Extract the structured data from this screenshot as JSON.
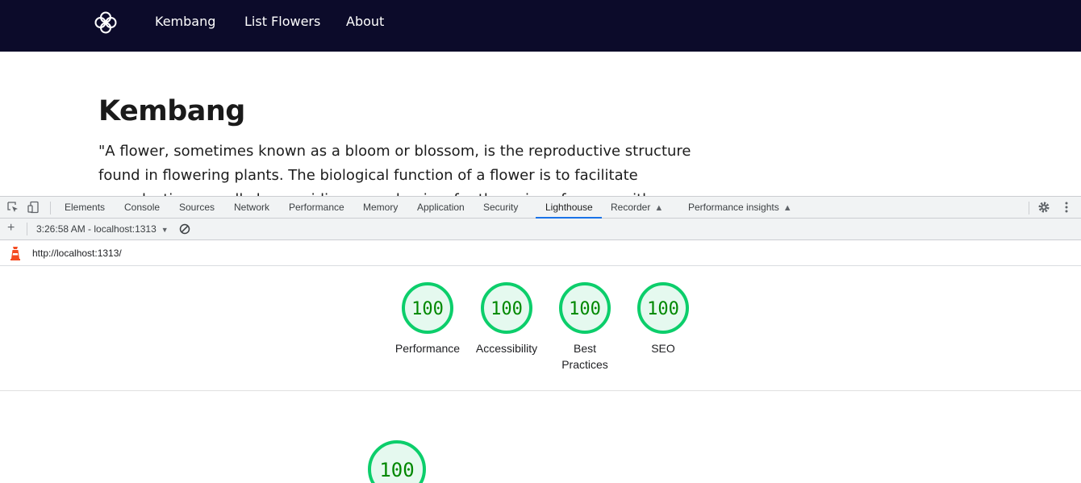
{
  "site": {
    "nav": {
      "logo_icon": "flower-icon",
      "links": [
        "Kembang",
        "List Flowers",
        "About"
      ]
    },
    "title": "Kembang",
    "quote": "\"A flower, sometimes known as a bloom or blossom, is the reproductive structure found in flowering plants. The biological function of a flower is to facilitate reproduction, usually by providing a mechanism for the union of sperm with eggs. Flo"
  },
  "devtools": {
    "tabs": [
      {
        "label": "Elements"
      },
      {
        "label": "Console"
      },
      {
        "label": "Sources"
      },
      {
        "label": "Network"
      },
      {
        "label": "Performance"
      },
      {
        "label": "Memory"
      },
      {
        "label": "Application"
      },
      {
        "label": "Security"
      },
      {
        "label": "Lighthouse",
        "active": true
      },
      {
        "label": "Recorder",
        "experimental": true
      },
      {
        "label": "Performance insights",
        "experimental": true
      }
    ],
    "icons": {
      "inspect": "inspect-element-icon",
      "device": "device-toolbar-icon",
      "settings": "gear-icon",
      "more": "more-vertical-icon"
    }
  },
  "lighthouse": {
    "toolbar": {
      "new_report": "+",
      "report_select": "3:26:58 AM - localhost:1313",
      "clear_icon": "clear-icon"
    },
    "url": "http://localhost:1313/",
    "gauges": [
      {
        "score": "100",
        "label_lines": [
          "Performance"
        ],
        "value": 100
      },
      {
        "score": "100",
        "label_lines": [
          "Accessibility"
        ],
        "value": 100
      },
      {
        "score": "100",
        "label_lines": [
          "Best",
          "Practices"
        ],
        "value": 100
      },
      {
        "score": "100",
        "label_lines": [
          "SEO"
        ],
        "value": 100
      }
    ],
    "section_gauge": {
      "score": "100",
      "value": 100
    },
    "colors": {
      "pass": "#0cce6b",
      "pass_fill": "#e5f9ef",
      "pass_text": "#008800"
    }
  }
}
